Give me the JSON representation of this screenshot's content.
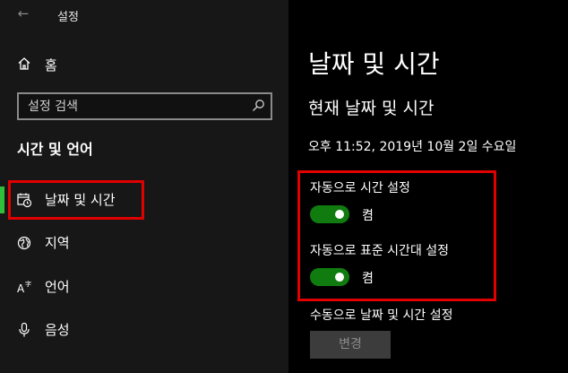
{
  "window": {
    "title": "설정"
  },
  "sidebar": {
    "home_label": "홈",
    "search": {
      "placeholder": "설정 검색"
    },
    "section_title": "시간 및 언어",
    "items": [
      {
        "label": "날짜 및 시간",
        "icon": "calendar-clock-icon",
        "active": true
      },
      {
        "label": "지역",
        "icon": "globe-icon"
      },
      {
        "label": "언어",
        "icon": "language-icon"
      },
      {
        "label": "음성",
        "icon": "microphone-icon"
      }
    ]
  },
  "main": {
    "page_title": "날짜 및 시간",
    "subtitle": "현재 날짜 및 시간",
    "current_datetime": "오후 11:52, 2019년 10월 2일 수요일",
    "settings": [
      {
        "label": "자동으로 시간 설정",
        "state": "켬",
        "on": true
      },
      {
        "label": "자동으로 표준 시간대 설정",
        "state": "켬",
        "on": true
      }
    ],
    "manual_label": "수동으로 날짜 및 시간 설정",
    "change_button": "변경"
  },
  "colors": {
    "toggle_on": "#107c10",
    "highlight": "#e00000",
    "active_indicator": "#2fbf3a",
    "sidebar_bg": "#171717",
    "main_bg": "#000000"
  }
}
